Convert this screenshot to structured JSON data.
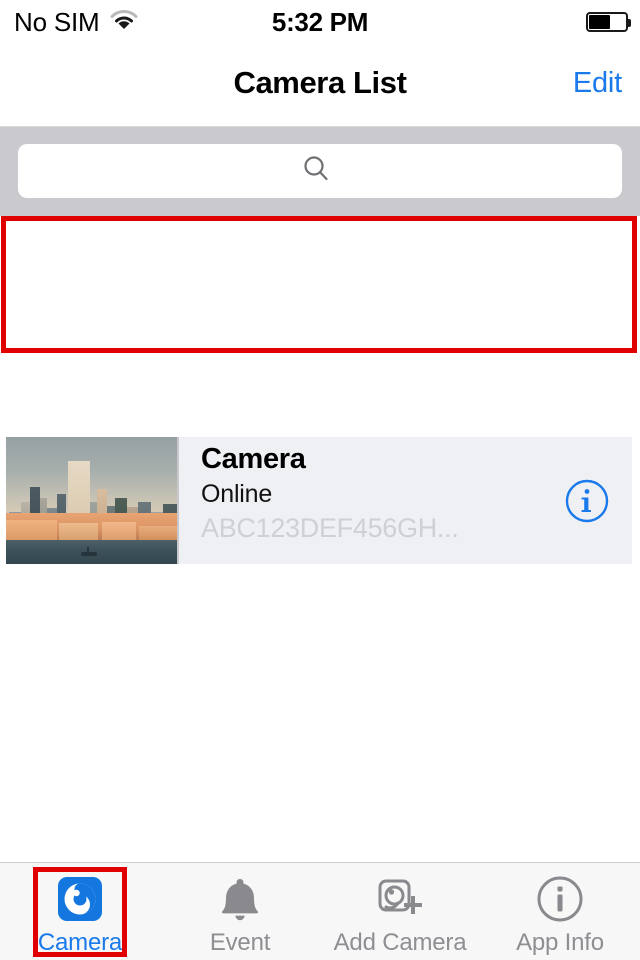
{
  "status_bar": {
    "carrier": "No SIM",
    "wifi_icon": "wifi-icon",
    "time": "5:32 PM",
    "battery_icon": "battery-icon",
    "battery_level_percent": 55
  },
  "nav_bar": {
    "title": "Camera List",
    "edit_label": "Edit",
    "accent_color": "#1a7aec"
  },
  "search": {
    "icon": "search-icon",
    "value": "",
    "placeholder": ""
  },
  "camera_list": {
    "rows": [
      {
        "name": "Camera",
        "status": "Online",
        "uid": "ABC123DEF456GH...",
        "thumbnail": "city-skyline-harbor-thumbnail",
        "info_button_icon": "info-circle-icon",
        "highlighted": true
      }
    ],
    "highlight_color": "#e00000"
  },
  "tab_bar": {
    "items": [
      {
        "label": "Camera",
        "icon": "camera-icon",
        "selected": true,
        "highlighted": true
      },
      {
        "label": "Event",
        "icon": "bell-icon",
        "selected": false,
        "highlighted": false
      },
      {
        "label": "Add Camera",
        "icon": "add-camera-icon",
        "selected": false,
        "highlighted": false
      },
      {
        "label": "App Info",
        "icon": "info-circle-icon",
        "selected": false,
        "highlighted": false
      }
    ],
    "selected_color": "#1a7aec",
    "inactive_color": "#8e8e93"
  }
}
